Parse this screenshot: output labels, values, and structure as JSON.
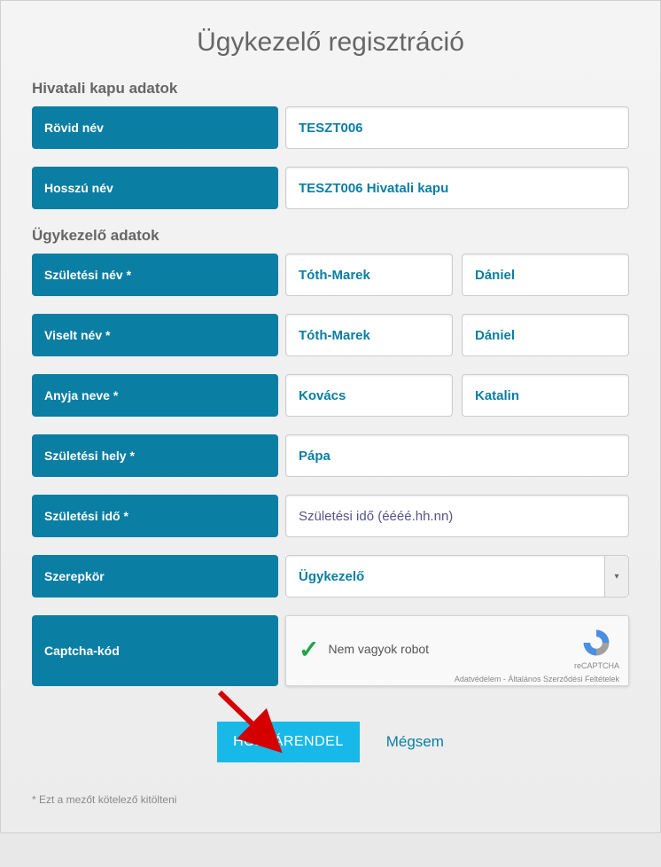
{
  "title": "Ügykezelő regisztráció",
  "section1": {
    "heading": "Hivatali kapu adatok",
    "short_name": {
      "label": "Rövid név",
      "value": "TESZT006"
    },
    "long_name": {
      "label": "Hosszú név",
      "value": "TESZT006 Hivatali kapu"
    }
  },
  "section2": {
    "heading": "Ügykezelő adatok",
    "birth_name": {
      "label": "Születési név *",
      "last": "Tóth-Marek",
      "first": "Dániel"
    },
    "used_name": {
      "label": "Viselt név *",
      "last": "Tóth-Marek",
      "first": "Dániel"
    },
    "mother_name": {
      "label": "Anyja neve *",
      "last": "Kovács",
      "first": "Katalin"
    },
    "birth_place": {
      "label": "Születési hely *",
      "value": "Pápa"
    },
    "birth_date": {
      "label": "Születési idő *",
      "placeholder": "Születési idő (éééé.hh.nn)"
    },
    "role": {
      "label": "Szerepkör",
      "value": "Ügykezelő"
    },
    "captcha": {
      "label": "Captcha-kód",
      "text": "Nem vagyok robot",
      "brand": "reCAPTCHA",
      "legal": "Adatvédelem - Általános Szerződési Feltételek"
    }
  },
  "buttons": {
    "submit": "HOZZÁRENDEL",
    "cancel": "Mégsem"
  },
  "footnote": "* Ezt a mezőt kötelező kitölteni"
}
